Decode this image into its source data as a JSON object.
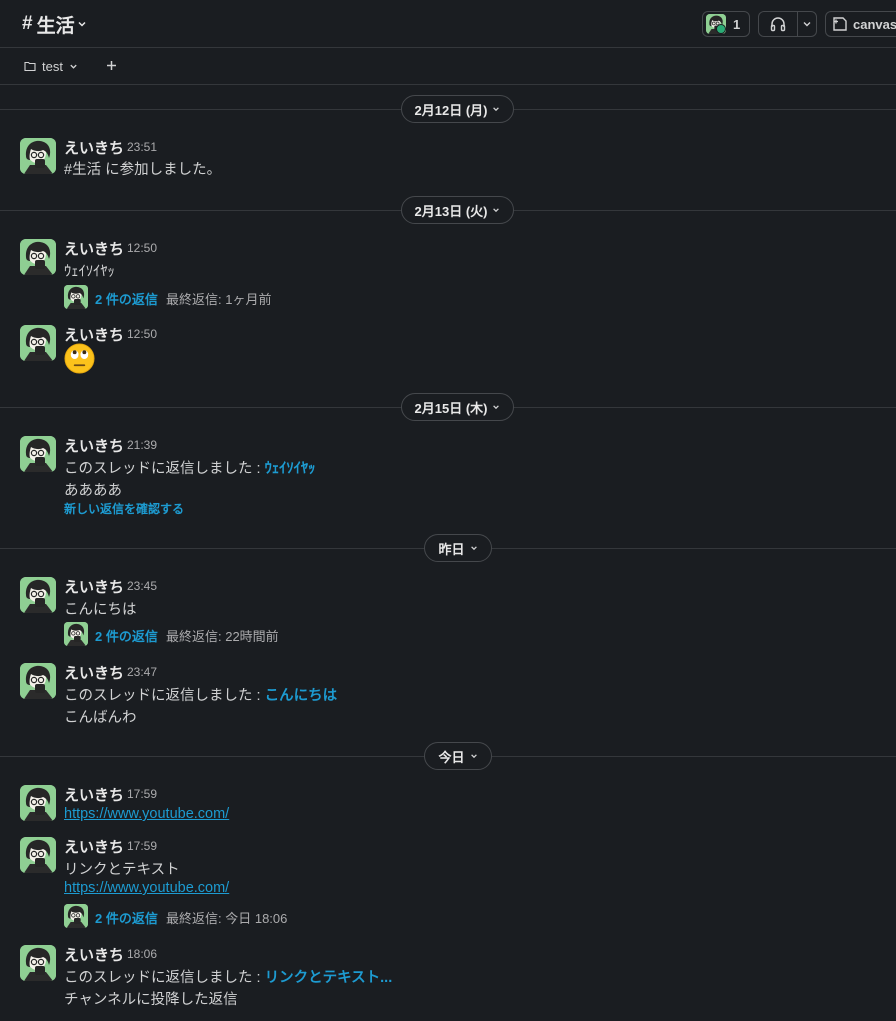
{
  "header": {
    "channel_hash": "#",
    "channel_name": "生活",
    "member_count": "1",
    "canvas_label": "canvas"
  },
  "tabs": {
    "test_label": "test"
  },
  "dates": {
    "d1": "2月12日 (月)",
    "d2": "2月13日 (火)",
    "d3": "2月15日 (木)",
    "d4": "昨日",
    "d5": "今日"
  },
  "user": "えいきち",
  "messages": {
    "m1": {
      "time": "23:51",
      "text": "#生活 に参加しました。"
    },
    "m2": {
      "time": "12:50",
      "text": "ｳｪｲｿｲﾔｯ",
      "replies": "2 件の返信",
      "last": "最終返信: 1ヶ月前"
    },
    "m3": {
      "time": "12:50"
    },
    "m4": {
      "time": "21:39",
      "prefix": "このスレッドに返信しました :",
      "thread": "ｳｪｲｿｲﾔｯ",
      "text": "ああああ",
      "new_replies": "新しい返信を確認する"
    },
    "m5": {
      "time": "23:45",
      "text": "こんにちは",
      "replies": "2 件の返信",
      "last": "最終返信: 22時間前"
    },
    "m6": {
      "time": "23:47",
      "prefix": "このスレッドに返信しました :",
      "thread": "こんにちは",
      "text": "こんばんわ"
    },
    "m7": {
      "time": "17:59",
      "url": "https://www.youtube.com/"
    },
    "m8": {
      "time": "17:59",
      "text": "リンクとテキスト",
      "url": "https://www.youtube.com/",
      "replies": "2 件の返信",
      "last": "最終返信: 今日 18:06"
    },
    "m9": {
      "time": "18:06",
      "prefix": "このスレッドに返信しました :",
      "thread": "リンクとテキスト...",
      "text": "チャンネルに投降した返信"
    }
  },
  "colors": {
    "background": "#1a1d21",
    "link": "#1d9bd1",
    "avatar_bg": "#8fcf93"
  }
}
